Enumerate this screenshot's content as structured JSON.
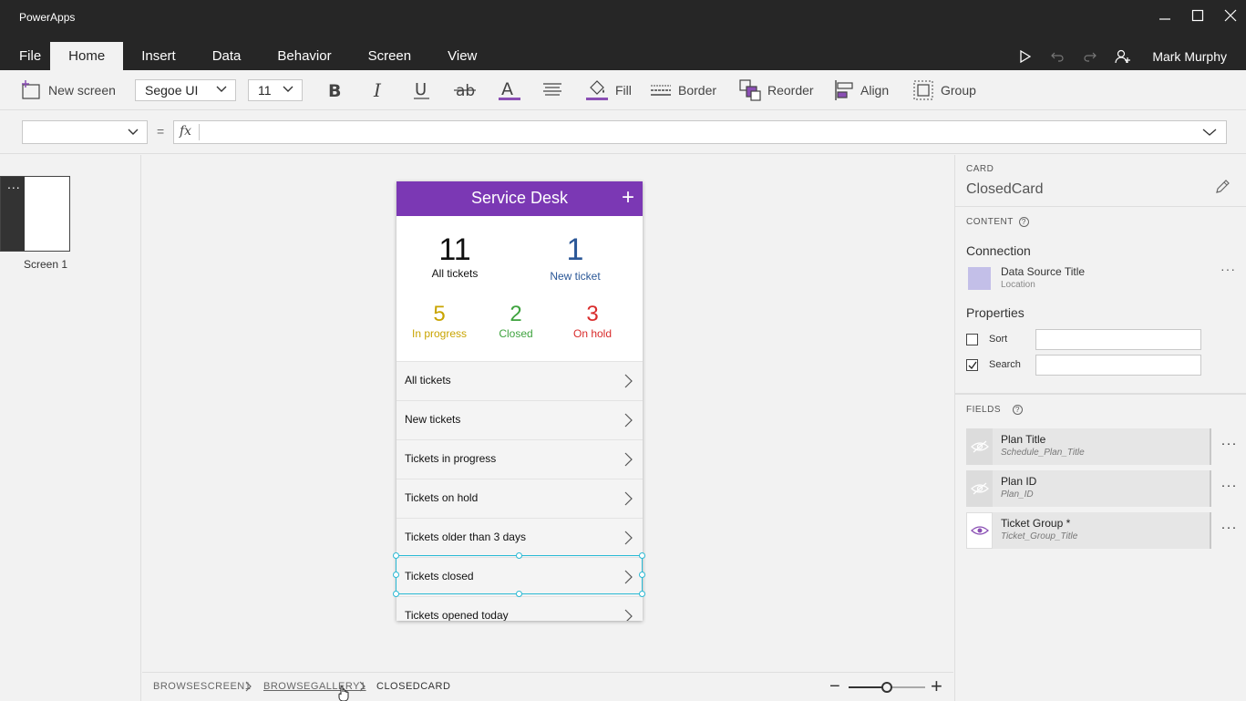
{
  "app": {
    "title": "PowerApps"
  },
  "menu": {
    "tabs": [
      {
        "label": "File"
      },
      {
        "label": "Home"
      },
      {
        "label": "Insert"
      },
      {
        "label": "Data"
      },
      {
        "label": "Behavior"
      },
      {
        "label": "Screen"
      },
      {
        "label": "View"
      }
    ],
    "active_tab": "Home",
    "user_name": "Mark Murphy"
  },
  "ribbon": {
    "new_screen": "New screen",
    "font": "Segoe UI",
    "font_size": "11",
    "fill": "Fill",
    "border": "Border",
    "reorder": "Reorder",
    "align": "Align",
    "group": "Group",
    "accent_color": "#8a4fb4"
  },
  "formula": {
    "equals": "=",
    "fx": "fx",
    "property": "",
    "value": ""
  },
  "screens": {
    "items": [
      {
        "label": "Screen 1",
        "menu": "..."
      }
    ]
  },
  "phone": {
    "header_color": "#7b38b4",
    "title": "Service Desk",
    "add_glyph": "+",
    "stats": {
      "all": {
        "value": "11",
        "label": "All tickets"
      },
      "new": {
        "value": "1",
        "label": "New ticket",
        "color": "#2b5797"
      },
      "in_progress": {
        "value": "5",
        "label": "In progress",
        "color": "#c9a400"
      },
      "closed": {
        "value": "2",
        "label": "Closed",
        "color": "#3fa33f"
      },
      "on_hold": {
        "value": "3",
        "label": "On hold",
        "color": "#d92b2b"
      }
    },
    "list": [
      "All tickets",
      "New tickets",
      "Tickets in progress",
      "Tickets on hold",
      "Tickets older than 3 days",
      "Tickets closed",
      "Tickets opened today"
    ],
    "selected_index": 5
  },
  "breadcrumb": {
    "items": [
      "BROWSESCREEN1",
      "BROWSEGALLERY1",
      "CLOSEDCARD"
    ]
  },
  "zoom": {
    "minus": "−",
    "plus": "+",
    "level": 0.5
  },
  "properties": {
    "card_caption": "CARD",
    "card_name": "ClosedCard",
    "content_caption": "CONTENT",
    "connection_heading": "Connection",
    "data_source_title": "Data Source Title",
    "data_source_sub": "Location",
    "more": "···",
    "properties_heading": "Properties",
    "sort_label": "Sort",
    "sort_checked": false,
    "search_label": "Search",
    "search_checked": true,
    "fields_caption": "FIELDS",
    "help": "?",
    "fields": [
      {
        "name": "Plan Title",
        "sub": "Schedule_Plan_Title",
        "visible": false
      },
      {
        "name": "Plan ID",
        "sub": "Plan_ID",
        "visible": false
      },
      {
        "name": "Ticket Group *",
        "sub": "Ticket_Group_Title",
        "visible": true
      }
    ]
  }
}
